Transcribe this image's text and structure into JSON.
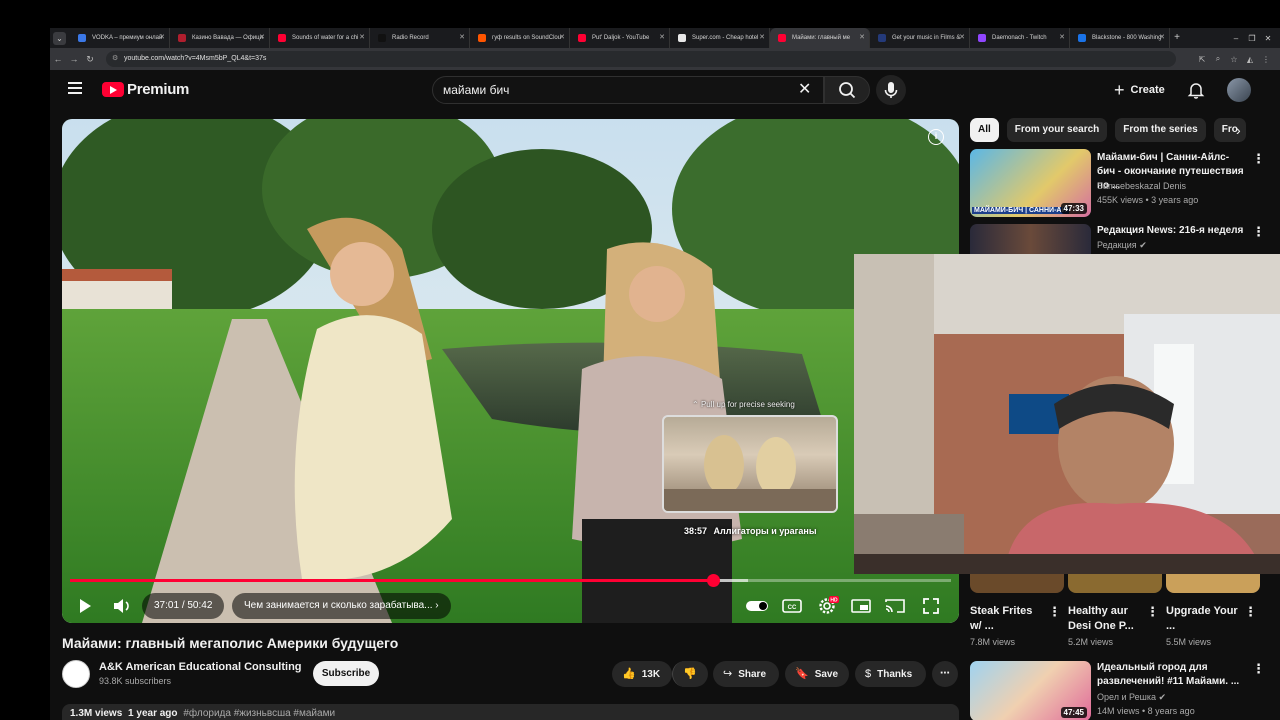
{
  "browser": {
    "tabs": [
      {
        "title": "VODKA – премиум онлай",
        "color": "#3b78e7"
      },
      {
        "title": "Казино Вавада — Офици",
        "color": "#b01e2e"
      },
      {
        "title": "Sounds of water for a chi",
        "color": "#ff0033"
      },
      {
        "title": "Radio Record",
        "color": "#111111"
      },
      {
        "title": "гуф results on SoundClou",
        "color": "#ff5500"
      },
      {
        "title": "Put' Daljok - YouTube",
        "color": "#ff0033"
      },
      {
        "title": "Super.com - Cheap hotel",
        "color": "#e8e8e8"
      },
      {
        "title": "Майами: главный ме",
        "color": "#ff0033"
      },
      {
        "title": "Get your music in Films &",
        "color": "#243a7a"
      },
      {
        "title": "Daemonach - Twitch",
        "color": "#9146ff"
      },
      {
        "title": "Blackstone - 800 Washing",
        "color": "#1a73e8"
      }
    ],
    "active_tab_index": 7,
    "url": "youtube.com/watch?v=4Msm5bP_QL4&t=37s"
  },
  "header": {
    "logo_text": "Premium",
    "search_value": "майами бич",
    "create_label": "Create"
  },
  "player": {
    "time_current": "37:01",
    "time_separator": "/",
    "time_total": "50:42",
    "progress_fraction": 0.73,
    "hover_fraction": 0.77,
    "chapter_label": "Чем занимается и сколько зарабатыва...",
    "pull_hint": "Pull up for precise seeking",
    "preview_time": "38:57",
    "preview_chapter": "Аллигаторы и ураганы",
    "settings_badge": "HD",
    "info_glyph": "i"
  },
  "video": {
    "title": "Майами: главный мегаполис Америки будущего",
    "channel": "A&K American Educational Consulting",
    "subscribers": "93.8K subscribers",
    "subscribe_label": "Subscribe",
    "likes": "13K",
    "share_label": "Share",
    "save_label": "Save",
    "thanks_label": "Thanks",
    "views": "1.3M views",
    "age": "1 year ago",
    "hashtags": "#флорида #жизньвсша #майами"
  },
  "chips": [
    "All",
    "From your search",
    "From the series",
    "Fro"
  ],
  "recommendations": [
    {
      "title": "Майами-бич | Санни-Айлс-бич - окончание путешествия по ...",
      "channel": "Samsebeskazal Denis",
      "meta": "455K views • 3 years ago",
      "duration": "47:33",
      "thumb_label": "МАЙАМИ-БИЧ | САННИ-АЙ"
    },
    {
      "title": "Редакция News: 216-я неделя",
      "channel": "Редакция",
      "meta": "",
      "duration": ""
    },
    {
      "title": "Идеальный город для развлечений! #11 Майами. ...",
      "channel": "Орел и Решка",
      "meta": "14M views • 8 years ago",
      "duration": "47:45"
    }
  ],
  "shorts": [
    {
      "title": "Steak Frites w/ ...",
      "views": "7.8M views"
    },
    {
      "title": "Healthy aur Desi One P...",
      "views": "5.2M views"
    },
    {
      "title": "Upgrade Your ...",
      "views": "5.5M views"
    }
  ],
  "colors": {
    "accent": "#ff0033",
    "background": "#0f0f0f",
    "surface": "#272727"
  }
}
